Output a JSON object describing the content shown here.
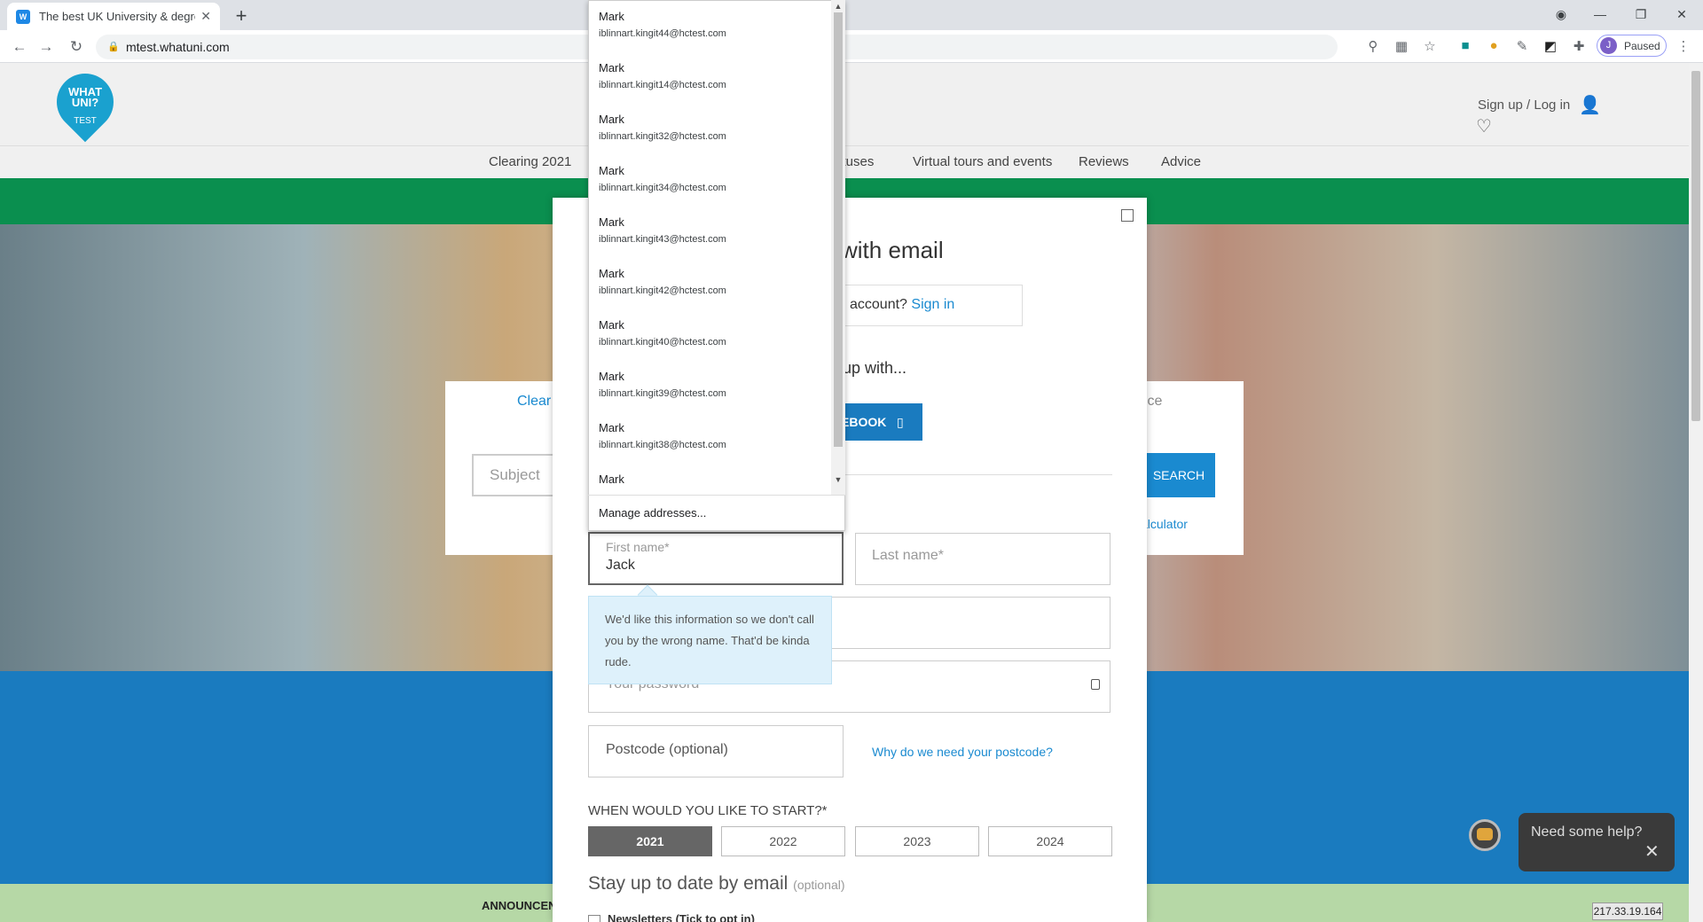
{
  "browser": {
    "tab_title": "The best UK University & degree",
    "tab_close": "✕",
    "new_tab": "+",
    "url": "mtest.whatuni.com",
    "profile_initial": "J",
    "profile_status": "Paused"
  },
  "site": {
    "logo_text": "WHAT UNI?",
    "logo_sub": "TEST",
    "header_signup": "Sign up / Log in",
    "nav": [
      "Clearing 2021",
      "ctuses",
      "Virtual tours and events",
      "Reviews",
      "Advice"
    ],
    "hero_tab_left": "Clear",
    "hero_tab_right": "ice",
    "hero_subject_placeholder": "Subject",
    "hero_search": "SEARCH",
    "hero_link": "alculator",
    "announcement": "ANNOUNCEN",
    "ip": "217.33.19.164"
  },
  "modal": {
    "title": "with email",
    "signin_question": "account? ",
    "signin_link": "Sign in",
    "signup_with": "up with...",
    "facebook_btn": "EBOOK",
    "first_name_label": "First name*",
    "first_name_value": "Jack",
    "last_name_placeholder": "Last name*",
    "tooltip": "We'd like this information so we don't call you by the wrong name. That'd be kinda rude.",
    "password_placeholder": "Your password",
    "postcode_placeholder": "Postcode (optional)",
    "postcode_why": "Why do we need your postcode?",
    "start_heading": "WHEN WOULD YOU LIKE TO START?*",
    "years": [
      "2021",
      "2022",
      "2023",
      "2024"
    ],
    "selected_year": "2021",
    "stay_heading": "Stay up to date by email",
    "stay_optional": "(optional)",
    "newsletter_label": "Newsletters (Tick to opt in)"
  },
  "autofill": {
    "items": [
      {
        "name": "Mark",
        "email": "iblinnart.kingit44@hctest.com"
      },
      {
        "name": "Mark",
        "email": "iblinnart.kingit14@hctest.com"
      },
      {
        "name": "Mark",
        "email": "iblinnart.kingit32@hctest.com"
      },
      {
        "name": "Mark",
        "email": "iblinnart.kingit34@hctest.com"
      },
      {
        "name": "Mark",
        "email": "iblinnart.kingit43@hctest.com"
      },
      {
        "name": "Mark",
        "email": "iblinnart.kingit42@hctest.com"
      },
      {
        "name": "Mark",
        "email": "iblinnart.kingit40@hctest.com"
      },
      {
        "name": "Mark",
        "email": "iblinnart.kingit39@hctest.com"
      },
      {
        "name": "Mark",
        "email": "iblinnart.kingit38@hctest.com"
      },
      {
        "name": "Mark",
        "email": ""
      }
    ],
    "manage": "Manage addresses..."
  },
  "chat": {
    "help_text": "Need some help?"
  },
  "colors": {
    "accent": "#1a8ad0",
    "green_bar": "#0a8f4f",
    "blue_band": "#1a7bbf"
  }
}
